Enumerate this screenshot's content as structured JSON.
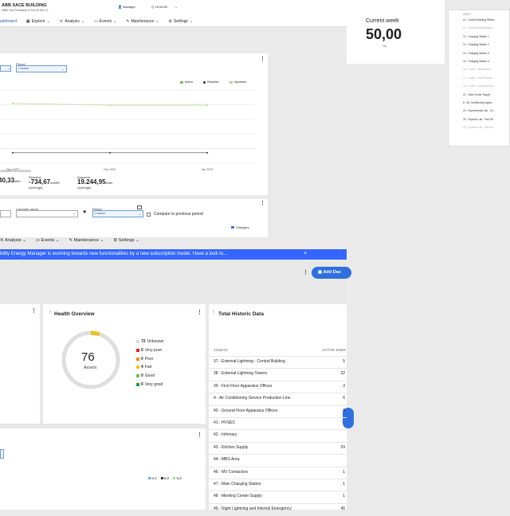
{
  "header": {
    "building": "ABB SACE BUILDING",
    "address": "ABB Via Pescaria 5 24123 BG IT",
    "user": "Manager",
    "period": "10/14/30",
    "tabs": [
      "ashboard",
      "Explore",
      "Analysis",
      "Events",
      "Maintenance",
      "Settings"
    ]
  },
  "current_week": {
    "title": "Current week",
    "value": "50,00",
    "unit": "Hz"
  },
  "assets_list": {
    "header": "ASSET",
    "items": [
      {
        "label": "10 - Central Building Offices",
        "faint": false
      },
      {
        "label": "11 - Central Building Mech...",
        "faint": true
      },
      {
        "label": "12 - Charging Station 1",
        "faint": false
      },
      {
        "label": "13 - Charging Station 2",
        "faint": false
      },
      {
        "label": "14 - Charging Station 3",
        "faint": false
      },
      {
        "label": "15 - Charging Station 4",
        "faint": false
      },
      {
        "label": "16 - Cooler - Automation...",
        "faint": true
      },
      {
        "label": "17 - Cooler - Unit Product...",
        "faint": true
      },
      {
        "label": "18 - Cooler - Lunching Sec...",
        "faint": true
      },
      {
        "label": "21 - Data Center Supply",
        "faint": false
      },
      {
        "label": "5 - Air Conditioning Appar...",
        "faint": false
      },
      {
        "label": "24 - Experimental Lab - Ch...",
        "faint": false
      },
      {
        "label": "25 - Experim Lab - Test Re...",
        "faint": false
      },
      {
        "label": "26 - Experim Lab - Test Re...",
        "faint": true
      }
    ]
  },
  "chart_card": {
    "dropdown_label": "Period",
    "dropdown_value": "Custom",
    "legend": [
      "Active",
      "Reactive",
      "Apparent"
    ],
    "x_ticks": [
      "Nov 2022",
      "Dec 2022",
      "Jan 2023"
    ],
    "range_note": "10/01/2022 to 10/01/2023",
    "stats": [
      {
        "value": "40,33",
        "unit": "kWh",
        "label": ""
      },
      {
        "value": "-734,67",
        "unit": "kVARh",
        "label": "Reactive",
        "sub": "(Average)"
      },
      {
        "value": "19.244,95",
        "unit": "kVAh",
        "label": "Apparent",
        "sub": "(Average)"
      }
    ],
    "prefix_text": "(Average)"
  },
  "chart_data": {
    "type": "line",
    "categories": [
      "Nov 2022",
      "Dec 2022",
      "Jan 2023"
    ],
    "series": [
      {
        "name": "Apparent",
        "values": [
          19.5,
          18.8,
          18.8
        ]
      },
      {
        "name": "Reactive",
        "values": [
          -0.7,
          -0.7,
          -0.7
        ]
      }
    ],
    "legend_position": "top-right"
  },
  "filter_card": {
    "compare_group_label": "Compare group",
    "period_label": "Period",
    "period_value": "Custom",
    "compare_label": "Compare to previous period",
    "legend": "Chargers"
  },
  "nav2": {
    "items": [
      "Analysis",
      "Events",
      "Maintenance",
      "Settings"
    ]
  },
  "banner": {
    "text": "bility Energy Manager is evolving towards new functionalities by a new subscription model. Have a look to...",
    "close": "×"
  },
  "toolbar": {
    "add_label": "Add Das"
  },
  "health": {
    "title": "Health Overview",
    "total": "76",
    "total_label": "Assets",
    "items": [
      {
        "count": "72",
        "label": "Unknown",
        "color": "#d9d9d9"
      },
      {
        "count": "0",
        "label": "Very poor",
        "color": "#e02020"
      },
      {
        "count": "0",
        "label": "Poor",
        "color": "#f08c00"
      },
      {
        "count": "4",
        "label": "Fair",
        "color": "#f2c21b"
      },
      {
        "count": "0",
        "label": "Good",
        "color": "#6cc24a"
      },
      {
        "count": "0",
        "label": "Very good",
        "color": "#1e9e3a"
      }
    ]
  },
  "historic": {
    "title": "Total Historic Data",
    "col_asset": "ASSETS",
    "col_active": "ACTIVE ENER",
    "rows": [
      {
        "asset": "37 - External Lightning - Central Building",
        "val": "5"
      },
      {
        "asset": "38 - External Lightning Towers",
        "val": "32"
      },
      {
        "asset": "39 - First Floor Apparatus Offices",
        "val": "3"
      },
      {
        "asset": "4 - Air Conditioning Service Production Line",
        "val": "6"
      },
      {
        "asset": "40 - Ground Floor Apparatus Offices",
        "val": "8"
      },
      {
        "asset": "41 - HVSEC",
        "val": ""
      },
      {
        "asset": "42 - Infirmary",
        "val": ""
      },
      {
        "asset": "43 - Kitchen Supply",
        "val": "29"
      },
      {
        "asset": "44 - MBS Area",
        "val": ""
      },
      {
        "asset": "46 - MV Contactors",
        "val": "1"
      },
      {
        "asset": "47 - Main Charging Station",
        "val": "1"
      },
      {
        "asset": "48 - Meeting Center Supply",
        "val": "1"
      },
      {
        "asset": "49 - Night Lightning and Internal Emergency",
        "val": "45"
      }
    ]
  },
  "bottom_card": {
    "legend": [
      "IL1",
      "IL2",
      "IL3"
    ]
  }
}
